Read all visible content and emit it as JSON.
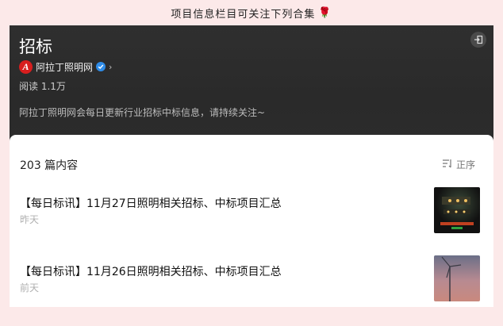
{
  "banner": {
    "text": "项目信息栏目可关注下列合集",
    "rose": "🌹"
  },
  "header": {
    "title": "招标",
    "account_name": "阿拉丁照明网",
    "logo_letter": "A",
    "chevron": "›",
    "reads": "阅读 1.1万",
    "description": "阿拉丁照明网会每日更新行业招标中标信息，请持续关注~"
  },
  "list": {
    "count_label": "203 篇内容",
    "sort_label": "正序",
    "articles": [
      {
        "title": "【每日标讯】11月27日照明相关招标、中标项目汇总",
        "date": "昨天"
      },
      {
        "title": "【每日标讯】11月26日照明相关招标、中标项目汇总",
        "date": "前天"
      }
    ]
  },
  "colors": {
    "page_bg": "#fce9e9",
    "header_bg": "#2c2c2c",
    "brand_red": "#d81e1e",
    "verified_blue": "#2f8ce8"
  }
}
